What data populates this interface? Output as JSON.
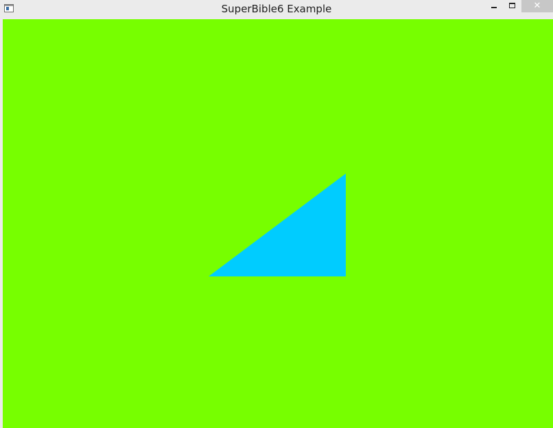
{
  "window": {
    "title": "SuperBible6 Example",
    "close_glyph": "✕",
    "icons": {
      "app": "window-app-icon",
      "minimize": "minimize-icon",
      "maximize": "maximize-icon",
      "close": "close-icon"
    }
  },
  "scene": {
    "background_color": "#77ff00",
    "triangle_color": "#00ccff"
  }
}
